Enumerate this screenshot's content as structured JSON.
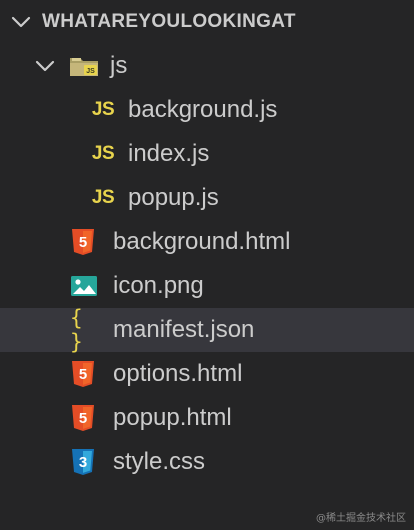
{
  "explorer": {
    "root_label": "WHATAREYOULOOKINGAT",
    "folder_js": "js",
    "files_js": [
      "background.js",
      "index.js",
      "popup.js"
    ],
    "files_root": [
      {
        "label": "background.html",
        "icon": "html5-icon"
      },
      {
        "label": "icon.png",
        "icon": "image-icon"
      },
      {
        "label": "manifest.json",
        "icon": "json-braces-icon",
        "selected": true
      },
      {
        "label": "options.html",
        "icon": "html5-icon"
      },
      {
        "label": "popup.html",
        "icon": "html5-icon"
      },
      {
        "label": "style.css",
        "icon": "css3-icon"
      }
    ],
    "js_badge": "JS",
    "json_badge": "{ }"
  },
  "watermark": "@稀土掘金技术社区",
  "colors": {
    "background": "#252526",
    "selected_row": "#37373d",
    "text": "#cccccc",
    "js_yellow": "#e8d44d",
    "html_orange": "#e44d26",
    "css_blue": "#1572b6",
    "image_green": "#26a69a",
    "folder_olive": "#c5b67a"
  }
}
